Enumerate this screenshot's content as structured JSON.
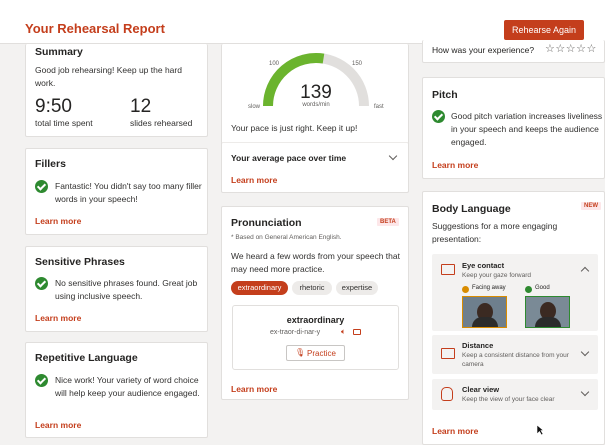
{
  "header": {
    "title": "Your Rehearsal Report",
    "button": "Rehearse Again"
  },
  "summary": {
    "title": "Summary",
    "message": "Good job rehearsing! Keep up the hard work.",
    "time_value": "9:50",
    "time_label": "total time spent",
    "slides_value": "12",
    "slides_label": "slides rehearsed"
  },
  "fillers": {
    "title": "Fillers",
    "message": "Fantastic! You didn't say too many filler words in your speech!",
    "learn": "Learn more"
  },
  "sensitive": {
    "title": "Sensitive Phrases",
    "message": "No sensitive phrases found. Great job using inclusive speech.",
    "learn": "Learn more"
  },
  "repetitive": {
    "title": "Repetitive Language",
    "message": "Nice work! Your variety of word choice will help keep your audience engaged.",
    "learn": "Learn more"
  },
  "pace": {
    "value": "139",
    "unit": "words/min",
    "scale_low": "100",
    "scale_high": "150",
    "slow": "slow",
    "fast": "fast",
    "gauge_fraction": 0.55,
    "message": "Your pace is just right. Keep it up!",
    "average": "Your average pace over time",
    "learn": "Learn more"
  },
  "pronunciation": {
    "title": "Pronunciation",
    "badge": "BETA",
    "note": "* Based on General American English.",
    "message": "We heard a few words from your speech that may need more practice.",
    "chips": [
      "extraordinary",
      "rhetoric",
      "expertise"
    ],
    "word": "extraordinary",
    "phonetic": "ex-traor-di-nar-y",
    "practice": "Practice",
    "learn": "Learn more"
  },
  "experience": {
    "question": "How was your experience?",
    "stars": "☆☆☆☆☆"
  },
  "pitch": {
    "title": "Pitch",
    "message": "Good pitch variation increases liveliness in your speech and keeps the audience engaged.",
    "learn": "Learn more"
  },
  "body_language": {
    "title": "Body Language",
    "badge": "NEW",
    "subtitle": "Suggestions for a more engaging presentation:",
    "eye_title": "Eye contact",
    "eye_sub": "Keep your gaze forward",
    "facing_away": "Facing away",
    "good": "Good",
    "distance_title": "Distance",
    "distance_sub": "Keep a consistent distance from your camera",
    "clear_title": "Clear view",
    "clear_sub": "Keep the view of your face clear",
    "learn": "Learn more"
  },
  "colors": {
    "accent": "#c43e1c",
    "success": "#2e8a30",
    "gauge": "#6bb42e"
  }
}
